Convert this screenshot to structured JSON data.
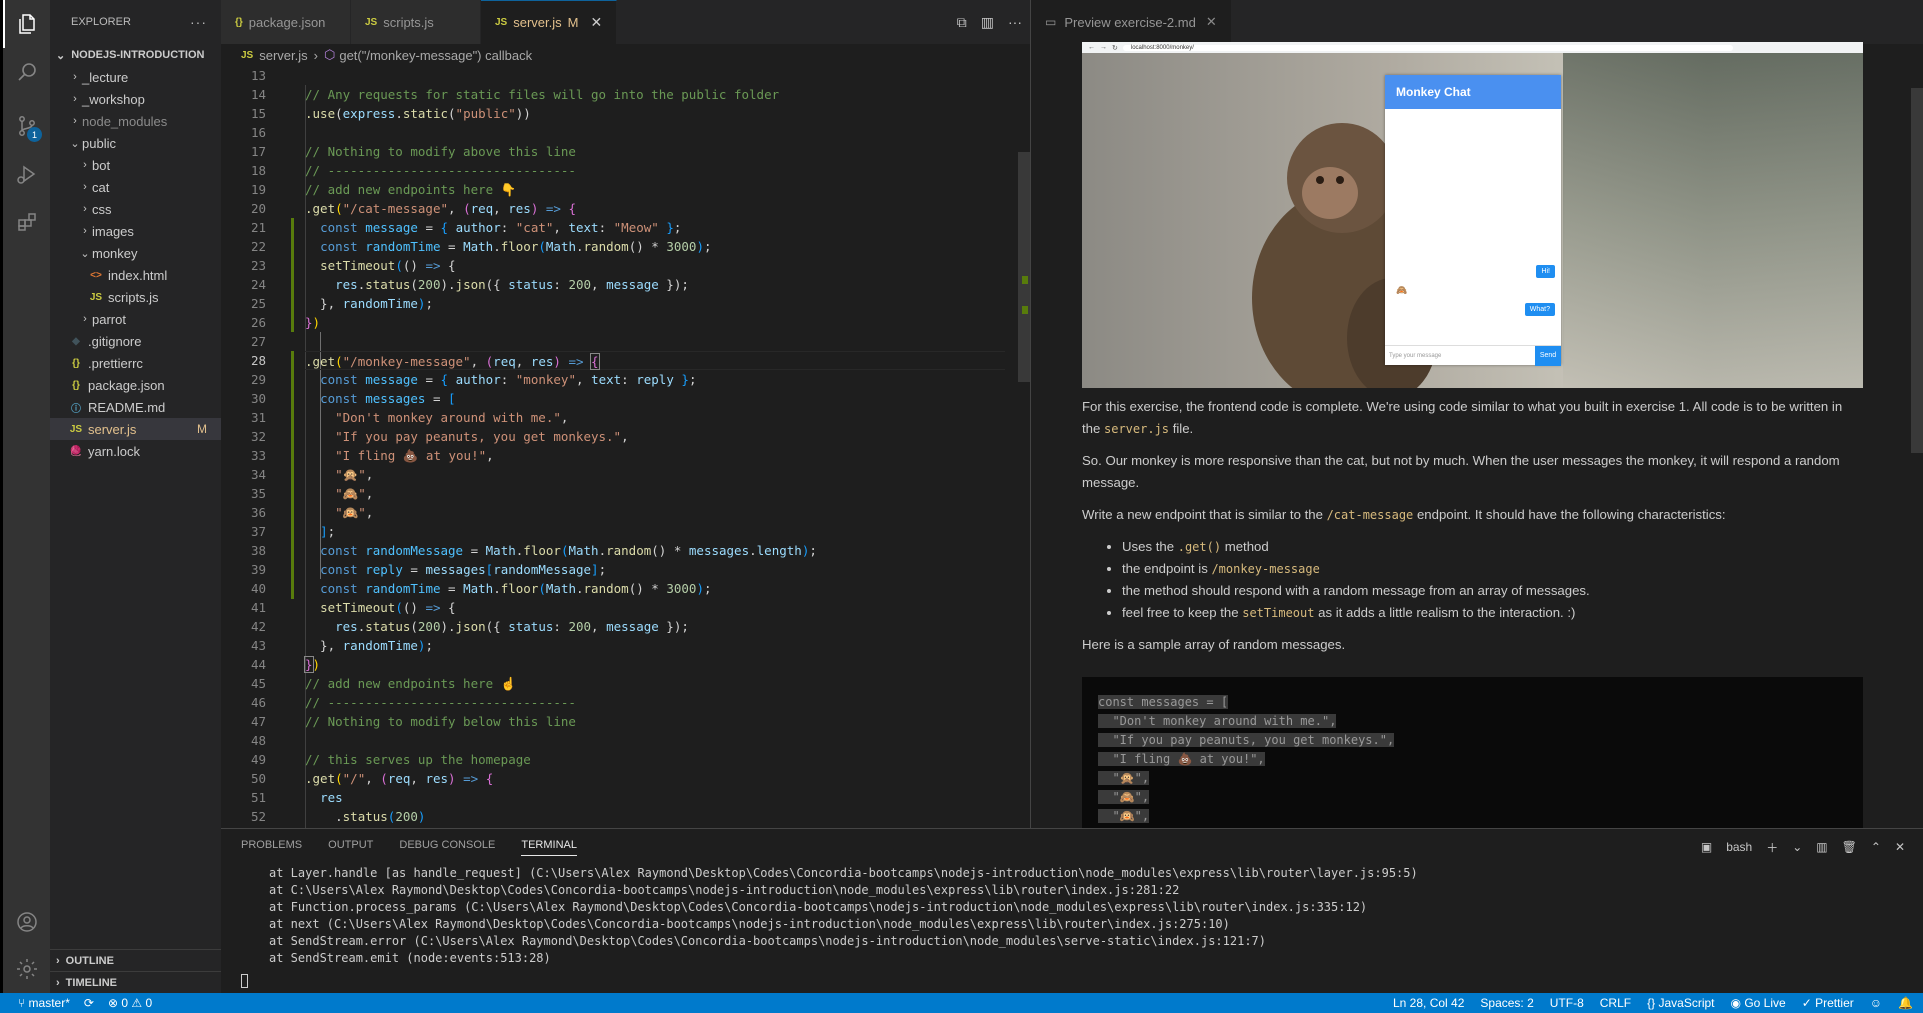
{
  "activity_bar": {
    "items": [
      {
        "name": "explorer-icon",
        "glyph": "⧉",
        "active": true
      },
      {
        "name": "search-icon",
        "glyph": "⌕"
      },
      {
        "name": "source-control-icon",
        "glyph": "⑂",
        "badge": "1"
      },
      {
        "name": "run-debug-icon",
        "glyph": "▷"
      },
      {
        "name": "extensions-icon",
        "glyph": "⊞"
      }
    ],
    "bottom": [
      {
        "name": "account-icon",
        "glyph": "◯"
      },
      {
        "name": "settings-gear-icon",
        "glyph": "⚙"
      }
    ]
  },
  "sidebar": {
    "title": "EXPLORER",
    "more": "···",
    "root": "NODEJS-INTRODUCTION",
    "items": [
      {
        "label": "_lecture",
        "chev": "›",
        "indent": 1
      },
      {
        "label": "_workshop",
        "chev": "›",
        "indent": 1
      },
      {
        "label": "node_modules",
        "chev": "›",
        "indent": 1,
        "dim": true
      },
      {
        "label": "public",
        "chev": "⌄",
        "indent": 1
      },
      {
        "label": "bot",
        "chev": "›",
        "indent": 2
      },
      {
        "label": "cat",
        "chev": "›",
        "indent": 2
      },
      {
        "label": "css",
        "chev": "›",
        "indent": 2
      },
      {
        "label": "images",
        "chev": "›",
        "indent": 2
      },
      {
        "label": "monkey",
        "chev": "⌄",
        "indent": 2
      },
      {
        "label": "index.html",
        "icon": "<>",
        "icon_color": "#e37933",
        "indent": 3
      },
      {
        "label": "scripts.js",
        "icon": "JS",
        "icon_color": "#cbcb41",
        "indent": 3
      },
      {
        "label": "parrot",
        "chev": "›",
        "indent": 2
      },
      {
        "label": ".gitignore",
        "icon": "◆",
        "icon_color": "#41535b",
        "indent": 1
      },
      {
        "label": ".prettierrc",
        "icon": "{}",
        "icon_color": "#cbcb41",
        "indent": 1
      },
      {
        "label": "package.json",
        "icon": "{}",
        "icon_color": "#cbcb41",
        "indent": 1
      },
      {
        "label": "README.md",
        "icon": "ⓘ",
        "icon_color": "#519aba",
        "indent": 1
      },
      {
        "label": "server.js",
        "icon": "JS",
        "icon_color": "#cbcb41",
        "indent": 1,
        "selected": true,
        "modified": "M"
      },
      {
        "label": "yarn.lock",
        "icon": "🧶",
        "icon_color": "#519aba",
        "indent": 1
      }
    ],
    "outline": "OUTLINE",
    "timeline": "TIMELINE"
  },
  "editor": {
    "tabs": [
      {
        "label": "package.json",
        "icon": "{}",
        "icon_color": "#cbcb41"
      },
      {
        "label": "scripts.js",
        "icon": "JS",
        "icon_color": "#cbcb41"
      },
      {
        "label": "server.js",
        "icon": "JS",
        "icon_color": "#cbcb41",
        "active": true,
        "modified": "M"
      }
    ],
    "breadcrumb": {
      "file": "server.js",
      "symbol": "get(\"/monkey-message\") callback"
    },
    "current_line": "28",
    "line_numbers": [
      "13",
      "14",
      "15",
      "16",
      "17",
      "18",
      "19",
      "20",
      "21",
      "22",
      "23",
      "24",
      "25",
      "26",
      "27",
      "28",
      "29",
      "30",
      "31",
      "32",
      "33",
      "34",
      "35",
      "36",
      "37",
      "38",
      "39",
      "40",
      "41",
      "42",
      "43",
      "44",
      "45",
      "46",
      "47",
      "48",
      "49",
      "50",
      "51",
      "52"
    ],
    "code": [
      "",
      "<span class='c-cm'>// Any requests for static files will go into the public folder</span>",
      "<span class='c-fn'>.use</span>(<span class='c-vr'>express</span>.<span class='c-fn'>static</span>(<span class='c-st'>\"public\"</span>))",
      "",
      "<span class='c-cm'>// Nothing to modify above this line</span>",
      "<span class='c-cm'>// ---------------------------------</span>",
      "<span class='c-cm'>// add new endpoints here 👇</span>",
      "<span class='c-fn'>.get</span><span class='c-br1'>(</span><span class='c-st'>\"/cat-message\"</span>, <span class='c-br2'>(</span><span class='c-vr'>req</span>, <span class='c-vr'>res</span><span class='c-br2'>)</span> <span class='c-kw'>=&gt;</span> <span class='c-br2'>{</span>",
      "  <span class='c-kw'>const</span> <span class='c-cn'>message</span> = <span class='c-br3'>{</span> <span class='c-vr'>author</span>: <span class='c-st'>\"cat\"</span>, <span class='c-vr'>text</span>: <span class='c-st'>\"Meow\"</span> <span class='c-br3'>}</span>;",
      "  <span class='c-kw'>const</span> <span class='c-cn'>randomTime</span> = <span class='c-vr'>Math</span>.<span class='c-fn'>floor</span><span class='c-br3'>(</span><span class='c-vr'>Math</span>.<span class='c-fn'>random</span>() * <span class='c-nm'>3000</span><span class='c-br3'>)</span>;",
      "  <span class='c-fn'>setTimeout</span><span class='c-br3'>(</span>() <span class='c-kw'>=&gt;</span> {",
      "    <span class='c-vr'>res</span>.<span class='c-fn'>status</span>(<span class='c-nm'>200</span>).<span class='c-fn'>json</span>({ <span class='c-vr'>status</span>: <span class='c-nm'>200</span>, <span class='c-vr'>message</span> });",
      "  }, <span class='c-vr'>randomTime</span><span class='c-br3'>)</span>;",
      "<span class='c-br2'>}</span><span class='c-br1'>)</span>",
      "",
      "<span class='c-fn'>.get</span><span class='c-br1'>(</span><span class='c-st'>\"/monkey-message\"</span>, <span class='c-br2'>(</span><span class='c-vr'>req</span>, <span class='c-vr'>res</span><span class='c-br2'>)</span> <span class='c-kw'>=&gt;</span> <span class='c-br2' style='outline:1px solid #888'>{</span>",
      "  <span class='c-kw'>const</span> <span class='c-cn'>message</span> = <span class='c-br3'>{</span> <span class='c-vr'>author</span>: <span class='c-st'>\"monkey\"</span>, <span class='c-vr'>text</span>: <span class='c-vr'>reply</span> <span class='c-br3'>}</span>;",
      "  <span class='c-kw'>const</span> <span class='c-cn'>messages</span> = <span class='c-br3'>[</span>",
      "    <span class='c-st'>\"Don't monkey around with me.\"</span>,",
      "    <span class='c-st'>\"If you pay peanuts, you get monkeys.\"</span>,",
      "    <span class='c-st'>\"I fling 💩 at you!\"</span>,",
      "    <span class='c-st'>\"🙊\"</span>,",
      "    <span class='c-st'>\"🙈\"</span>,",
      "    <span class='c-st'>\"🙉\"</span>,",
      "  <span class='c-br3'>]</span>;",
      "  <span class='c-kw'>const</span> <span class='c-cn'>randomMessage</span> = <span class='c-vr'>Math</span>.<span class='c-fn'>floor</span><span class='c-br3'>(</span><span class='c-vr'>Math</span>.<span class='c-fn'>random</span>() * <span class='c-vr'>messages</span>.<span class='c-vr'>length</span><span class='c-br3'>)</span>;",
      "  <span class='c-kw'>const</span> <span class='c-cn'>reply</span> = <span class='c-vr'>messages</span><span class='c-br3'>[</span><span class='c-vr'>randomMessage</span><span class='c-br3'>]</span>;",
      "  <span class='c-kw'>const</span> <span class='c-cn'>randomTime</span> = <span class='c-vr'>Math</span>.<span class='c-fn'>floor</span><span class='c-br3'>(</span><span class='c-vr'>Math</span>.<span class='c-fn'>random</span>() * <span class='c-nm'>3000</span><span class='c-br3'>)</span>;",
      "  <span class='c-fn'>setTimeout</span><span class='c-br3'>(</span>() <span class='c-kw'>=&gt;</span> {",
      "    <span class='c-vr'>res</span>.<span class='c-fn'>status</span>(<span class='c-nm'>200</span>).<span class='c-fn'>json</span>({ <span class='c-vr'>status</span>: <span class='c-nm'>200</span>, <span class='c-vr'>message</span> });",
      "  }, <span class='c-vr'>randomTime</span><span class='c-br3'>)</span>;",
      "<span class='c-br2' style='outline:1px solid #888'>}</span><span class='c-br1'>)</span>",
      "<span class='c-cm'>// add new endpoints here ☝️</span>",
      "<span class='c-cm'>// ---------------------------------</span>",
      "<span class='c-cm'>// Nothing to modify below this line</span>",
      "",
      "<span class='c-cm'>// this serves up the homepage</span>",
      "<span class='c-fn'>.get</span><span class='c-br1'>(</span><span class='c-st'>\"/\"</span>, <span class='c-br2'>(</span><span class='c-vr'>req</span>, <span class='c-vr'>res</span><span class='c-br2'>)</span> <span class='c-kw'>=&gt;</span> <span class='c-br2'>{</span>",
      "  <span class='c-vr'>res</span>",
      "    .<span class='c-fn'>status</span><span class='c-br3'>(</span><span class='c-nm'>200</span><span class='c-br3'>)</span>"
    ]
  },
  "preview": {
    "tab": "Preview exercise-2.md",
    "browser_url": "localhost:8000/monkey/",
    "chat": {
      "title": "Monkey Chat",
      "bubble_1": "Hi!",
      "bubble_2": "What?",
      "avatar": "🙈",
      "input_placeholder": "Type your message",
      "send": "Send"
    },
    "paragraphs": [
      {
        "before": "For this exercise, the frontend code is complete. We're using code similar to what you built in exercise 1. All code is to be written in the ",
        "code": "server.js",
        "after": " file."
      },
      {
        "before": "So. Our monkey is more responsive than the cat, but not by much. When the user messages the monkey, it will respond a random message.",
        "code": "",
        "after": ""
      },
      {
        "before": "Write a new endpoint that is similar to the ",
        "code": "/cat-message",
        "after": " endpoint. It should have the following characteristics:"
      }
    ],
    "bullets": [
      {
        "before": "Uses the ",
        "code": ".get()",
        "after": " method"
      },
      {
        "before": "the endpoint is ",
        "code": "/monkey-message",
        "after": ""
      },
      {
        "before": "the method should respond with a random message from an array of messages.",
        "code": "",
        "after": ""
      },
      {
        "before": "feel free to keep the ",
        "code": "setTimeout",
        "after": " as it adds a little realism to the interaction. :)"
      }
    ],
    "sample_intro": "Here is a sample array of random messages.",
    "sample_code": [
      "const messages = [",
      "  \"Don't monkey around with me.\",",
      "  \"If you pay peanuts, you get monkeys.\",",
      "  \"I fling 💩 at you!\",",
      "  \"🙊\",",
      "  \"🙈\",",
      "  \"🙉\","
    ]
  },
  "panel": {
    "tabs": [
      "PROBLEMS",
      "OUTPUT",
      "DEBUG CONSOLE",
      "TERMINAL"
    ],
    "active_tab": "TERMINAL",
    "shell": "bash",
    "terminal_lines": [
      "at Layer.handle [as handle_request] (C:\\Users\\Alex Raymond\\Desktop\\Codes\\Concordia-bootcamps\\nodejs-introduction\\node_modules\\express\\lib\\router\\layer.js:95:5)",
      "at C:\\Users\\Alex Raymond\\Desktop\\Codes\\Concordia-bootcamps\\nodejs-introduction\\node_modules\\express\\lib\\router\\index.js:281:22",
      "at Function.process_params (C:\\Users\\Alex Raymond\\Desktop\\Codes\\Concordia-bootcamps\\nodejs-introduction\\node_modules\\express\\lib\\router\\index.js:335:12)",
      "at next (C:\\Users\\Alex Raymond\\Desktop\\Codes\\Concordia-bootcamps\\nodejs-introduction\\node_modules\\express\\lib\\router\\index.js:275:10)",
      "at SendStream.error (C:\\Users\\Alex Raymond\\Desktop\\Codes\\Concordia-bootcamps\\nodejs-introduction\\node_modules\\serve-static\\index.js:121:7)",
      "at SendStream.emit (node:events:513:28)"
    ]
  },
  "status_bar": {
    "branch": "master*",
    "sync": "⟳",
    "errors": "0",
    "warnings": "0",
    "position": "Ln 28, Col 42",
    "spaces": "Spaces: 2",
    "encoding": "UTF-8",
    "eol": "CRLF",
    "language": "JavaScript",
    "go_live": "Go Live",
    "prettier": "Prettier"
  }
}
